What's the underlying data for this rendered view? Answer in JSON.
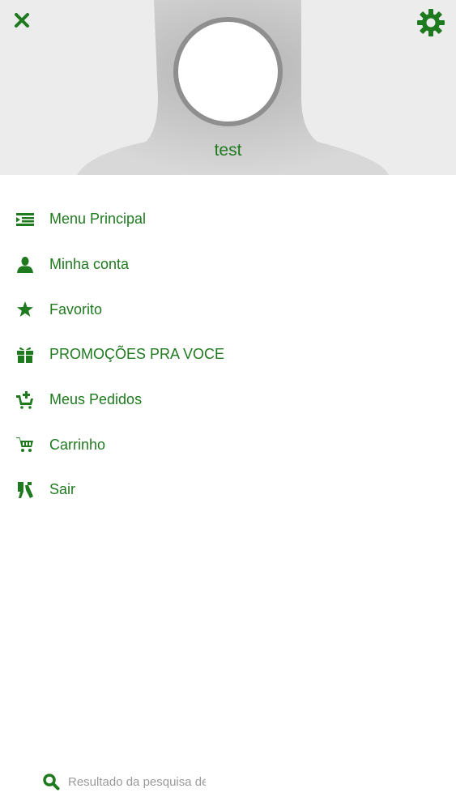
{
  "header": {
    "username": "test"
  },
  "menu": {
    "items": [
      {
        "label": "Menu Principal",
        "icon": "list-menu-icon"
      },
      {
        "label": "Minha conta",
        "icon": "user-icon"
      },
      {
        "label": "Favorito",
        "icon": "star-icon"
      },
      {
        "label": "PROMOÇÕES PRA VOCE",
        "icon": "gift-icon"
      },
      {
        "label": "Meus Pedidos",
        "icon": "basket-add-icon"
      },
      {
        "label": "Carrinho",
        "icon": "cart-icon"
      },
      {
        "label": "Sair",
        "icon": "exit-icon"
      }
    ]
  },
  "search": {
    "placeholder": "Resultado da pesquisa de"
  },
  "colors": {
    "accent": "#1f7a1f",
    "header_bg": "#ececec",
    "placeholder": "#9a9a9a"
  }
}
